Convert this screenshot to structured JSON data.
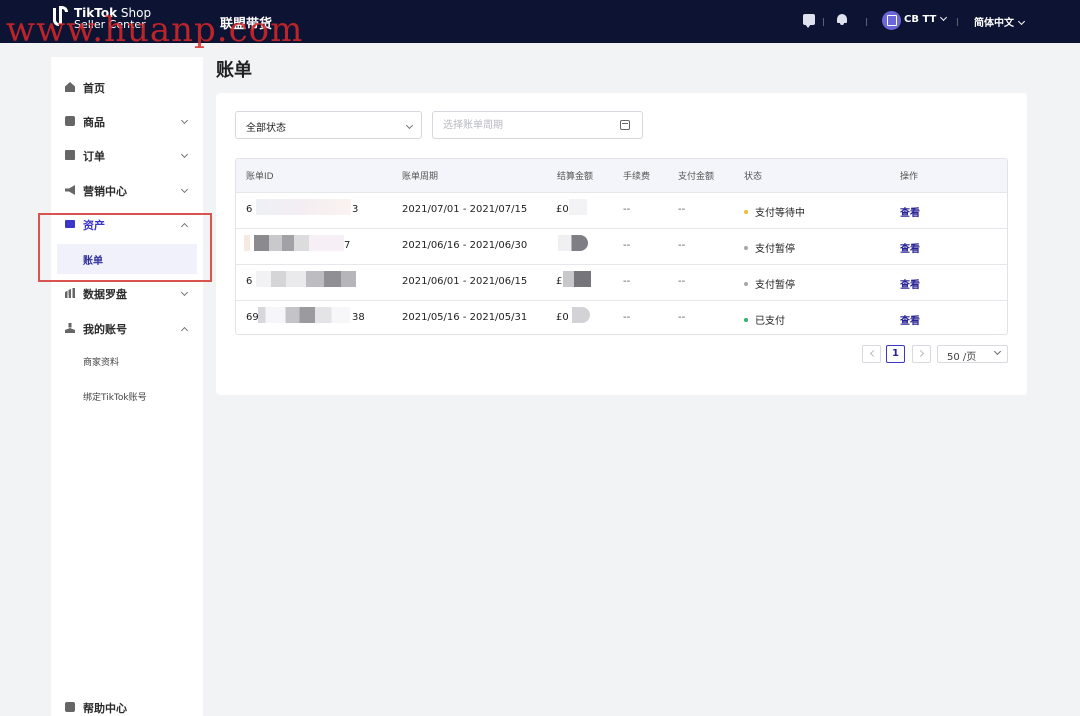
{
  "watermark": "www.huanp.com",
  "header": {
    "logo_line1": "TikTok",
    "logo_line1_suffix": " Shop",
    "logo_line2": "Seller Center",
    "title": "联盟带货",
    "user_name": "CB TT",
    "language": "简体中文"
  },
  "sidebar": {
    "items": [
      {
        "label": "首页",
        "icon": "home-icon"
      },
      {
        "label": "商品",
        "icon": "box-icon"
      },
      {
        "label": "订单",
        "icon": "order-icon"
      },
      {
        "label": "营销中心",
        "icon": "megaphone-icon"
      },
      {
        "label": "资产",
        "icon": "card-icon"
      },
      {
        "label": "数据罗盘",
        "icon": "bar-chart-icon"
      },
      {
        "label": "我的账号",
        "icon": "user-icon"
      },
      {
        "label": "帮助中心",
        "icon": "help-icon"
      }
    ],
    "asset_sub": "账单",
    "account_subs": [
      "商家资料",
      "绑定TikTok账号"
    ]
  },
  "page": {
    "title": "账单",
    "status_filter": "全部状态",
    "period_placeholder": "选择账单周期"
  },
  "table": {
    "columns": [
      "账单ID",
      "账单周期",
      "结算金额",
      "手续费",
      "支付金额",
      "状态",
      "操作"
    ],
    "rows": [
      {
        "id_start": "6",
        "id_end": "3",
        "period": "2021/07/01 - 2021/07/15",
        "amount": "£0",
        "fee": "--",
        "paid": "--",
        "status": "支付等待中",
        "status_color": "#f2b63c",
        "action": "查看"
      },
      {
        "id_start": "",
        "id_end": "7",
        "period": "2021/06/16 - 2021/06/30",
        "amount": "",
        "fee": "--",
        "paid": "--",
        "status": "支付暂停",
        "status_color": "#a5a6ad",
        "action": "查看"
      },
      {
        "id_start": "6",
        "id_end": "",
        "period": "2021/06/01 - 2021/06/15",
        "amount": "£",
        "fee": "--",
        "paid": "--",
        "status": "支付暂停",
        "status_color": "#a5a6ad",
        "action": "查看"
      },
      {
        "id_start": "69",
        "id_end": "38",
        "period": "2021/05/16 - 2021/05/31",
        "amount": "£0",
        "fee": "--",
        "paid": "--",
        "status": "已支付",
        "status_color": "#2bb36b",
        "action": "查看"
      }
    ]
  },
  "pagination": {
    "current_page": "1",
    "page_size": "50 /页"
  }
}
